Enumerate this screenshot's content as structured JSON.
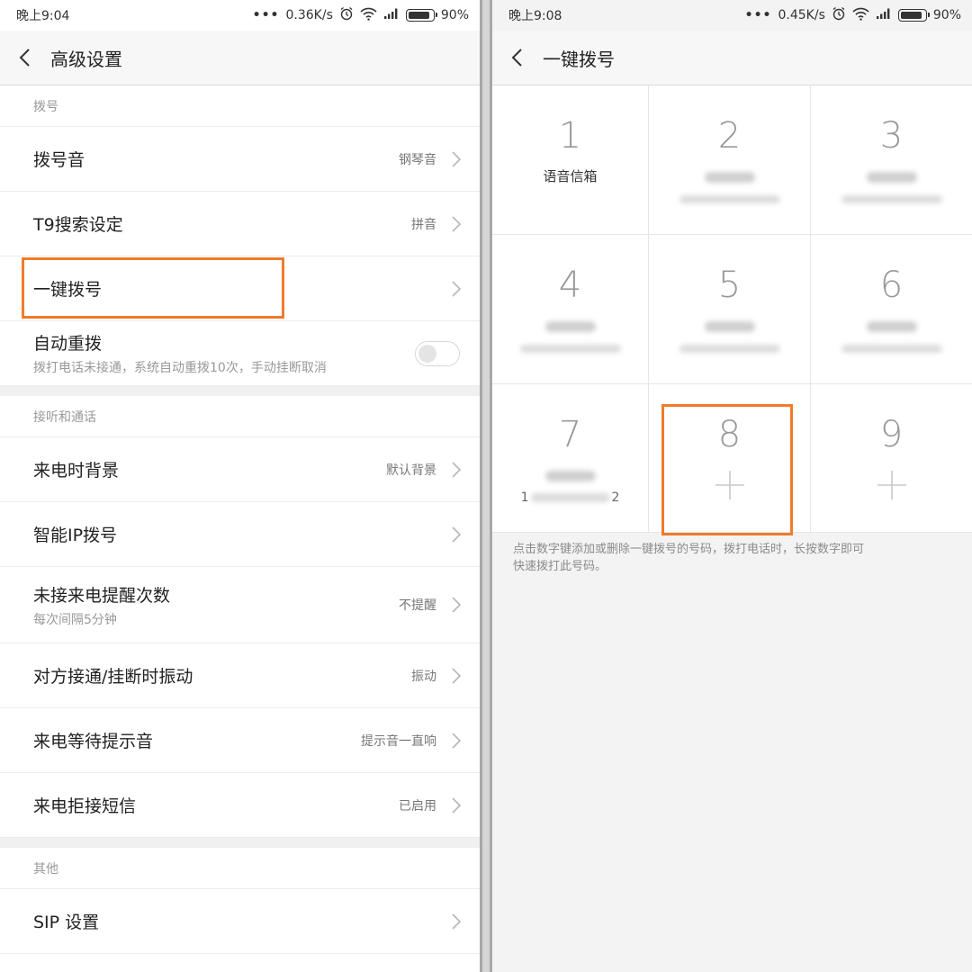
{
  "left": {
    "status": {
      "time": "晚上9:04",
      "dots": "•••",
      "speed": "0.36K/s",
      "battery": "90%"
    },
    "app_bar": {
      "title": "高级设置"
    },
    "sections": [
      {
        "header": "拨号"
      },
      {
        "header": "接听和通话"
      },
      {
        "header": "其他"
      }
    ],
    "rows": {
      "dial_tone": {
        "title": "拨号音",
        "value": "钢琴音"
      },
      "t9": {
        "title": "T9搜索设定",
        "value": "拼音"
      },
      "speed_dial": {
        "title": "一键拨号"
      },
      "auto_redial": {
        "title": "自动重拨",
        "sub": "拨打电话未接通，系统自动重拨10次，手动挂断取消",
        "enabled": false
      },
      "incoming_bg": {
        "title": "来电时背景",
        "value": "默认背景"
      },
      "smart_ip": {
        "title": "智能IP拨号"
      },
      "missed_reminder": {
        "title": "未接来电提醒次数",
        "sub": "每次间隔5分钟",
        "value": "不提醒"
      },
      "vibrate": {
        "title": "对方接通/挂断时振动",
        "value": "振动"
      },
      "waiting_tone": {
        "title": "来电等待提示音",
        "value": "提示音一直响"
      },
      "reject_sms": {
        "title": "来电拒接短信",
        "value": "已启用"
      },
      "sip": {
        "title": "SIP 设置"
      }
    }
  },
  "right": {
    "status": {
      "time": "晚上9:08",
      "dots": "•••",
      "speed": "0.45K/s",
      "battery": "90%"
    },
    "app_bar": {
      "title": "一键拨号"
    },
    "keys": [
      {
        "num": "1",
        "label": "语音信箱",
        "state": "voicemail"
      },
      {
        "num": "2",
        "state": "assigned-hidden"
      },
      {
        "num": "3",
        "state": "assigned-hidden"
      },
      {
        "num": "4",
        "state": "assigned-hidden"
      },
      {
        "num": "5",
        "state": "assigned-hidden"
      },
      {
        "num": "6",
        "state": "assigned-hidden"
      },
      {
        "num": "7",
        "number_start": "1",
        "number_end": "2",
        "state": "assigned-partial"
      },
      {
        "num": "8",
        "state": "empty",
        "icon": "plus-icon"
      },
      {
        "num": "9",
        "state": "empty",
        "icon": "plus-icon"
      }
    ],
    "hint": "点击数字键添加或删除一键拨号的号码，拨打电话时，长按数字即可快速拨打此号码。"
  },
  "colors": {
    "highlight": "#f07b2a",
    "section_text": "#999999",
    "divider": "#ececec"
  }
}
